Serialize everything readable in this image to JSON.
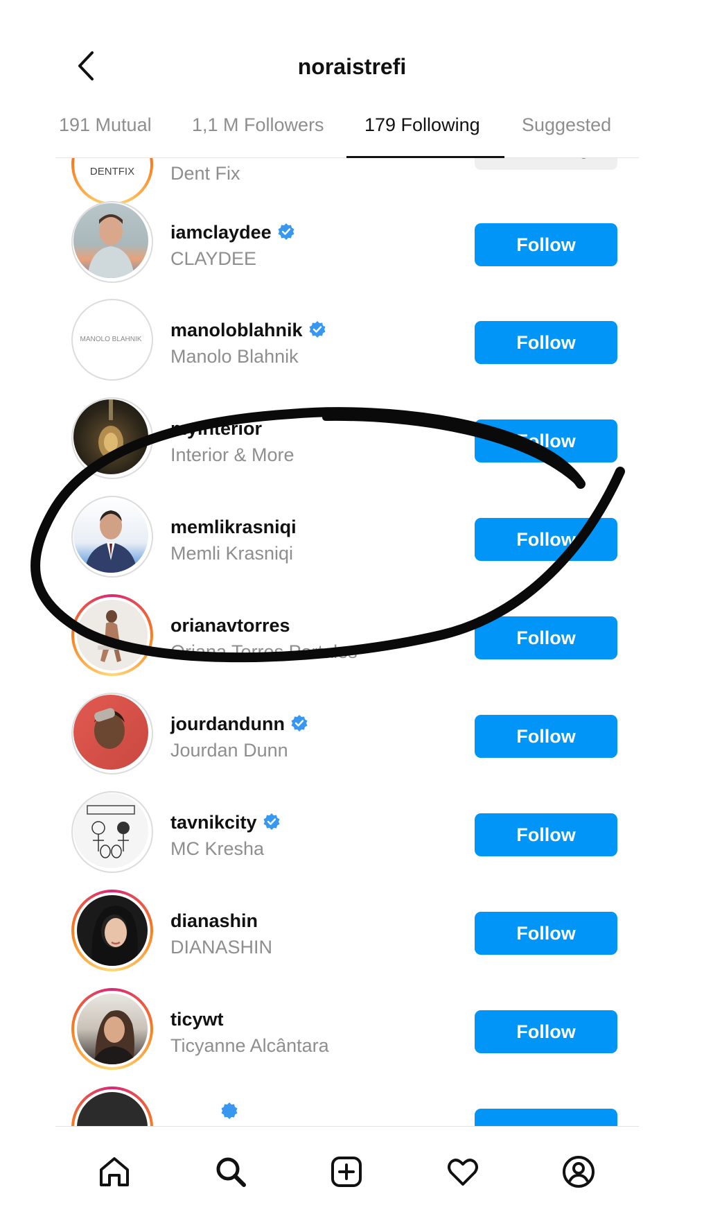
{
  "header": {
    "title": "noraistrefi",
    "back_icon": "chevron-left-icon"
  },
  "tabs": [
    {
      "label": "191 Mutual",
      "active": false
    },
    {
      "label": "1,1 M Followers",
      "active": false
    },
    {
      "label": "179 Following",
      "active": true
    },
    {
      "label": "Suggested",
      "active": false
    }
  ],
  "colors": {
    "accent": "#0095f6",
    "secondary_text": "#8e8e8e",
    "following_btn": "#efefef"
  },
  "accounts": [
    {
      "username": "",
      "full_name": "Dent Fix",
      "verified": false,
      "button": "Following",
      "avatar_text": "DENTFIX"
    },
    {
      "username": "iamclaydee",
      "full_name": "CLAYDEE",
      "verified": true,
      "button": "Follow"
    },
    {
      "username": "manoloblahnik",
      "full_name": "Manolo Blahnik",
      "verified": true,
      "button": "Follow",
      "avatar_text": "MANOLO BLAHNIK"
    },
    {
      "username": "myinterior",
      "full_name": "Interior & More",
      "verified": false,
      "button": "Follow"
    },
    {
      "username": "memlikrasniqi",
      "full_name": "Memli Krasniqi",
      "verified": false,
      "button": "Follow"
    },
    {
      "username": "orianavtorres",
      "full_name": "Oriana Torres Portales",
      "verified": false,
      "button": "Follow"
    },
    {
      "username": "jourdandunn",
      "full_name": "Jourdan Dunn",
      "verified": true,
      "button": "Follow"
    },
    {
      "username": "tavnikcity",
      "full_name": "MC Kresha",
      "verified": true,
      "button": "Follow"
    },
    {
      "username": "dianashin",
      "full_name": "DIANASHIN",
      "verified": false,
      "button": "Follow"
    },
    {
      "username": "ticywt",
      "full_name": "Ticyanne Alcântara",
      "verified": false,
      "button": "Follow"
    },
    {
      "username": "",
      "full_name": "",
      "verified": true,
      "button": ""
    }
  ],
  "nav": {
    "items": [
      "home-icon",
      "search-icon",
      "new-post-icon",
      "activity-heart-icon",
      "profile-icon"
    ]
  }
}
